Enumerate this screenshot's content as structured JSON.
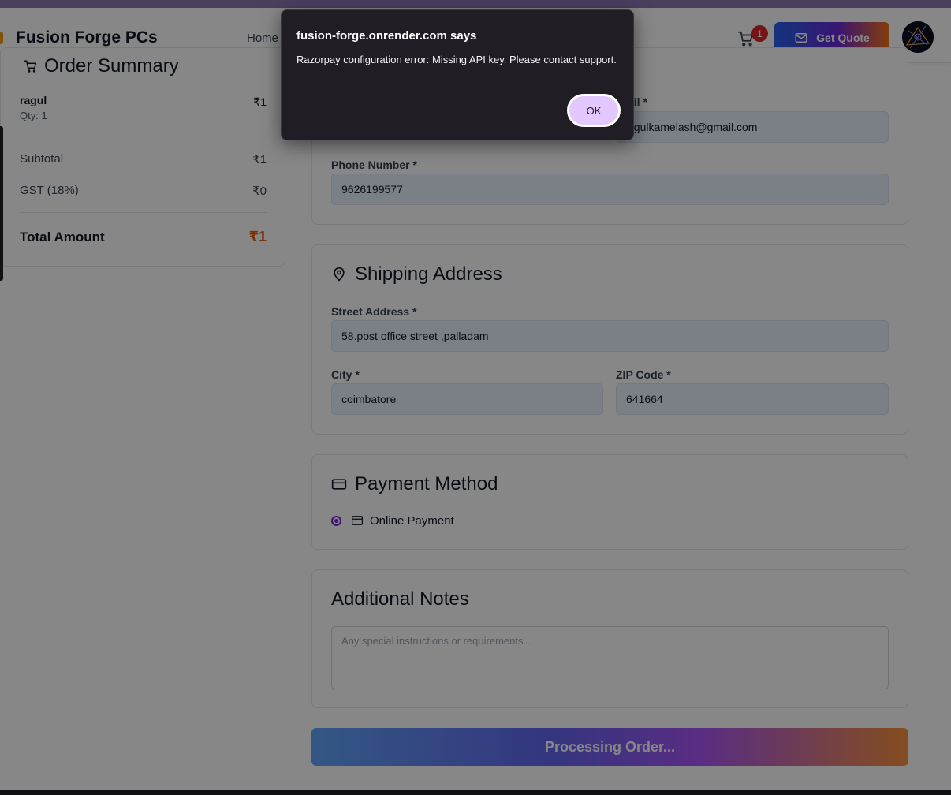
{
  "header": {
    "brand": "Fusion Forge PCs",
    "nav_home": "Home",
    "cart_count": "1",
    "quote_label": "Get Quote"
  },
  "summary": {
    "title": "Order Summary",
    "item": {
      "name": "ragul",
      "price": "₹1",
      "qty": "Qty: 1"
    },
    "subtotal_label": "Subtotal",
    "subtotal_value": "₹1",
    "gst_label": "GST (18%)",
    "gst_value": "₹0",
    "total_label": "Total Amount",
    "total_value": "₹1"
  },
  "contact": {
    "email_label_partial": "ail *",
    "email_value_partial": "agulkamelash@gmail.com",
    "phone_label": "Phone Number *",
    "phone_value": "9626199577"
  },
  "shipping": {
    "title": "Shipping Address",
    "street_label": "Street Address *",
    "street_value": "58.post office street ,palladam",
    "city_label": "City *",
    "city_value": "coimbatore",
    "zip_label": "ZIP Code *",
    "zip_value": "641664"
  },
  "payment": {
    "title": "Payment Method",
    "option_label": "Online Payment"
  },
  "notes": {
    "title": "Additional Notes",
    "placeholder": "Any special instructions or requirements..."
  },
  "submit_label": "Processing Order...",
  "dialog": {
    "title": "fusion-forge.onrender.com says",
    "message": "Razorpay configuration error: Missing API key. Please contact support.",
    "ok_label": "OK"
  }
}
